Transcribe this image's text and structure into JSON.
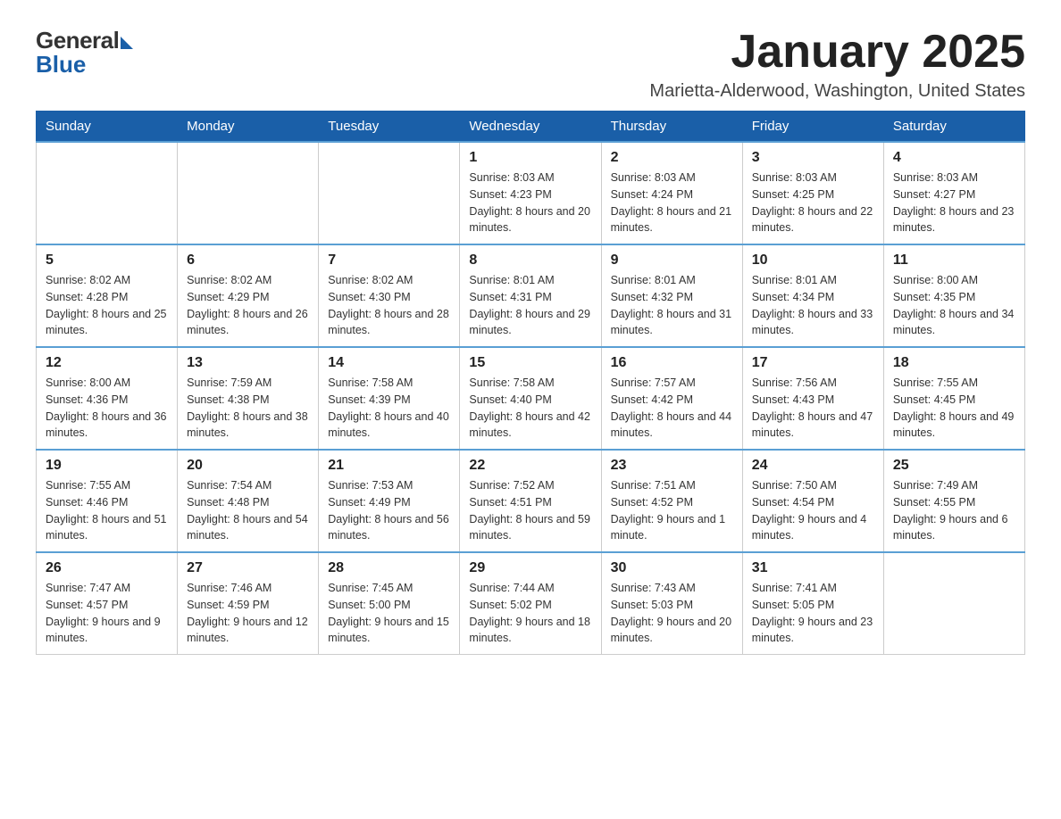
{
  "logo": {
    "general": "General",
    "blue": "Blue"
  },
  "header": {
    "month": "January 2025",
    "location": "Marietta-Alderwood, Washington, United States"
  },
  "weekdays": [
    "Sunday",
    "Monday",
    "Tuesday",
    "Wednesday",
    "Thursday",
    "Friday",
    "Saturday"
  ],
  "weeks": [
    [
      {
        "day": "",
        "info": ""
      },
      {
        "day": "",
        "info": ""
      },
      {
        "day": "",
        "info": ""
      },
      {
        "day": "1",
        "info": "Sunrise: 8:03 AM\nSunset: 4:23 PM\nDaylight: 8 hours and 20 minutes."
      },
      {
        "day": "2",
        "info": "Sunrise: 8:03 AM\nSunset: 4:24 PM\nDaylight: 8 hours and 21 minutes."
      },
      {
        "day": "3",
        "info": "Sunrise: 8:03 AM\nSunset: 4:25 PM\nDaylight: 8 hours and 22 minutes."
      },
      {
        "day": "4",
        "info": "Sunrise: 8:03 AM\nSunset: 4:27 PM\nDaylight: 8 hours and 23 minutes."
      }
    ],
    [
      {
        "day": "5",
        "info": "Sunrise: 8:02 AM\nSunset: 4:28 PM\nDaylight: 8 hours and 25 minutes."
      },
      {
        "day": "6",
        "info": "Sunrise: 8:02 AM\nSunset: 4:29 PM\nDaylight: 8 hours and 26 minutes."
      },
      {
        "day": "7",
        "info": "Sunrise: 8:02 AM\nSunset: 4:30 PM\nDaylight: 8 hours and 28 minutes."
      },
      {
        "day": "8",
        "info": "Sunrise: 8:01 AM\nSunset: 4:31 PM\nDaylight: 8 hours and 29 minutes."
      },
      {
        "day": "9",
        "info": "Sunrise: 8:01 AM\nSunset: 4:32 PM\nDaylight: 8 hours and 31 minutes."
      },
      {
        "day": "10",
        "info": "Sunrise: 8:01 AM\nSunset: 4:34 PM\nDaylight: 8 hours and 33 minutes."
      },
      {
        "day": "11",
        "info": "Sunrise: 8:00 AM\nSunset: 4:35 PM\nDaylight: 8 hours and 34 minutes."
      }
    ],
    [
      {
        "day": "12",
        "info": "Sunrise: 8:00 AM\nSunset: 4:36 PM\nDaylight: 8 hours and 36 minutes."
      },
      {
        "day": "13",
        "info": "Sunrise: 7:59 AM\nSunset: 4:38 PM\nDaylight: 8 hours and 38 minutes."
      },
      {
        "day": "14",
        "info": "Sunrise: 7:58 AM\nSunset: 4:39 PM\nDaylight: 8 hours and 40 minutes."
      },
      {
        "day": "15",
        "info": "Sunrise: 7:58 AM\nSunset: 4:40 PM\nDaylight: 8 hours and 42 minutes."
      },
      {
        "day": "16",
        "info": "Sunrise: 7:57 AM\nSunset: 4:42 PM\nDaylight: 8 hours and 44 minutes."
      },
      {
        "day": "17",
        "info": "Sunrise: 7:56 AM\nSunset: 4:43 PM\nDaylight: 8 hours and 47 minutes."
      },
      {
        "day": "18",
        "info": "Sunrise: 7:55 AM\nSunset: 4:45 PM\nDaylight: 8 hours and 49 minutes."
      }
    ],
    [
      {
        "day": "19",
        "info": "Sunrise: 7:55 AM\nSunset: 4:46 PM\nDaylight: 8 hours and 51 minutes."
      },
      {
        "day": "20",
        "info": "Sunrise: 7:54 AM\nSunset: 4:48 PM\nDaylight: 8 hours and 54 minutes."
      },
      {
        "day": "21",
        "info": "Sunrise: 7:53 AM\nSunset: 4:49 PM\nDaylight: 8 hours and 56 minutes."
      },
      {
        "day": "22",
        "info": "Sunrise: 7:52 AM\nSunset: 4:51 PM\nDaylight: 8 hours and 59 minutes."
      },
      {
        "day": "23",
        "info": "Sunrise: 7:51 AM\nSunset: 4:52 PM\nDaylight: 9 hours and 1 minute."
      },
      {
        "day": "24",
        "info": "Sunrise: 7:50 AM\nSunset: 4:54 PM\nDaylight: 9 hours and 4 minutes."
      },
      {
        "day": "25",
        "info": "Sunrise: 7:49 AM\nSunset: 4:55 PM\nDaylight: 9 hours and 6 minutes."
      }
    ],
    [
      {
        "day": "26",
        "info": "Sunrise: 7:47 AM\nSunset: 4:57 PM\nDaylight: 9 hours and 9 minutes."
      },
      {
        "day": "27",
        "info": "Sunrise: 7:46 AM\nSunset: 4:59 PM\nDaylight: 9 hours and 12 minutes."
      },
      {
        "day": "28",
        "info": "Sunrise: 7:45 AM\nSunset: 5:00 PM\nDaylight: 9 hours and 15 minutes."
      },
      {
        "day": "29",
        "info": "Sunrise: 7:44 AM\nSunset: 5:02 PM\nDaylight: 9 hours and 18 minutes."
      },
      {
        "day": "30",
        "info": "Sunrise: 7:43 AM\nSunset: 5:03 PM\nDaylight: 9 hours and 20 minutes."
      },
      {
        "day": "31",
        "info": "Sunrise: 7:41 AM\nSunset: 5:05 PM\nDaylight: 9 hours and 23 minutes."
      },
      {
        "day": "",
        "info": ""
      }
    ]
  ]
}
